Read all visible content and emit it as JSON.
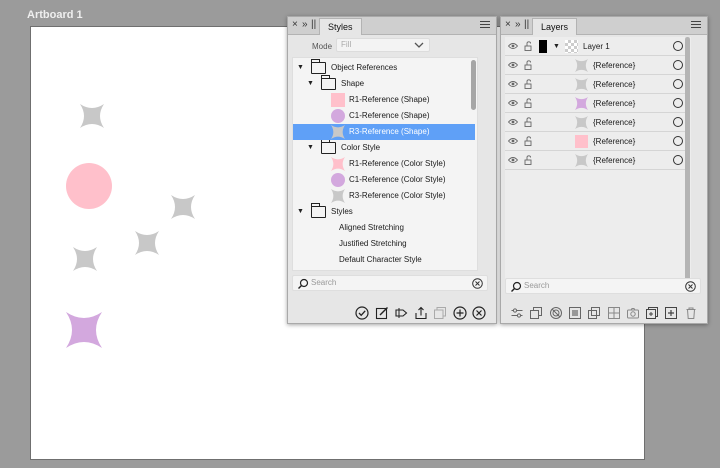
{
  "artboard": {
    "title": "Artboard 1"
  },
  "colors": {
    "pink": "#ffc0cb",
    "lilac": "#d3a8de",
    "gray": "#c8c8c8",
    "selection": "#5fa0f7"
  },
  "styles_panel": {
    "close_glyph": "×",
    "collapse_glyph": "»",
    "grip_glyph": "||",
    "tab": "Styles",
    "mode_label": "Mode",
    "mode_value": "Fill",
    "tree": [
      {
        "label": "Object References",
        "indent": 0,
        "kind": "folder",
        "expanded": true,
        "selected": false
      },
      {
        "label": "Shape",
        "indent": 1,
        "kind": "folder",
        "expanded": true,
        "selected": false
      },
      {
        "label": "R1-Reference (Shape)",
        "indent": 2,
        "kind": "rect-pink",
        "selected": false
      },
      {
        "label": "C1-Reference (Shape)",
        "indent": 2,
        "kind": "circle-lilac",
        "selected": false
      },
      {
        "label": "R3-Reference (Shape)",
        "indent": 2,
        "kind": "star-gray",
        "selected": true
      },
      {
        "label": "Color Style",
        "indent": 1,
        "kind": "folder",
        "expanded": true,
        "selected": false
      },
      {
        "label": "R1-Reference (Color Style)",
        "indent": 2,
        "kind": "star-pink",
        "selected": false
      },
      {
        "label": "C1-Reference (Color Style)",
        "indent": 2,
        "kind": "circle-lilac",
        "selected": false
      },
      {
        "label": "R3-Reference (Color Style)",
        "indent": 2,
        "kind": "star-gray",
        "selected": false
      },
      {
        "label": "Styles",
        "indent": 0,
        "kind": "folder",
        "expanded": true,
        "selected": false
      },
      {
        "label": "Aligned Stretching",
        "indent": 2,
        "kind": "none",
        "selected": false
      },
      {
        "label": "Justified Stretching",
        "indent": 2,
        "kind": "none",
        "selected": false
      },
      {
        "label": "Default Character Style",
        "indent": 2,
        "kind": "none",
        "selected": false
      }
    ],
    "search_placeholder": "Search",
    "toolbar_icons": [
      "apply-icon",
      "edit-style-icon",
      "tag-icon",
      "export-icon",
      "duplicate-icon",
      "add-icon",
      "remove-icon"
    ]
  },
  "layers_panel": {
    "close_glyph": "×",
    "collapse_glyph": "»",
    "grip_glyph": "||",
    "tab": "Layers",
    "rows": [
      {
        "label": "Layer 1",
        "kind": "layer"
      },
      {
        "label": "{Reference}",
        "kind": "star-gray"
      },
      {
        "label": "{Reference}",
        "kind": "star-gray"
      },
      {
        "label": "{Reference}",
        "kind": "star-lilac"
      },
      {
        "label": "{Reference}",
        "kind": "star-gray"
      },
      {
        "label": "{Reference}",
        "kind": "rect-pink"
      },
      {
        "label": "{Reference}",
        "kind": "star-gray"
      }
    ],
    "search_placeholder": "Search",
    "toolbar_icons": [
      "filter-icon",
      "layers-icon",
      "mask-icon",
      "clip-icon",
      "group-icon",
      "transparency-icon",
      "camera-icon",
      "add-page-icon",
      "add-layer-icon",
      "trash-icon"
    ]
  }
}
